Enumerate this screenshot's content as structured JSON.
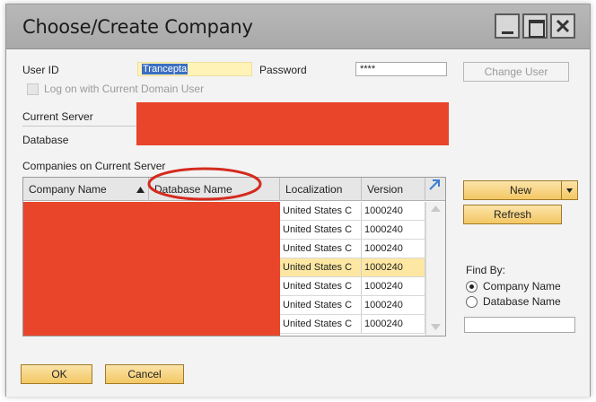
{
  "window": {
    "title": "Choose/Create Company"
  },
  "login": {
    "user_id_label": "User ID",
    "user_id_value": "Trancepta",
    "password_label": "Password",
    "password_value": "****",
    "change_user_label": "Change User",
    "domain_checkbox_label": "Log on with Current Domain User"
  },
  "server": {
    "current_server_label": "Current Server",
    "database_label": "Database"
  },
  "companies": {
    "section_label": "Companies on Current Server",
    "columns": [
      "Company Name",
      "Database Name",
      "Localization",
      "Version"
    ],
    "rows": [
      {
        "localization": "United States C",
        "version": "1000240"
      },
      {
        "localization": "United States C",
        "version": "1000240"
      },
      {
        "localization": "United States C",
        "version": "1000240"
      },
      {
        "localization": "United States C",
        "version": "1000240"
      },
      {
        "localization": "United States C",
        "version": "1000240"
      },
      {
        "localization": "United States C",
        "version": "1000240"
      },
      {
        "localization": "United States C",
        "version": "1000240"
      }
    ],
    "highlighted_row": 3
  },
  "actions": {
    "new_label": "New",
    "refresh_label": "Refresh",
    "ok_label": "OK",
    "cancel_label": "Cancel"
  },
  "find_by": {
    "label": "Find By:",
    "options": [
      "Company Name",
      "Database Name"
    ],
    "selected": "Company Name",
    "search_value": ""
  },
  "colors": {
    "accent": "#f3c764",
    "highlight_row": "#fde7a2",
    "redaction": "#e8452a",
    "annotation_circle": "#d42a1e"
  }
}
